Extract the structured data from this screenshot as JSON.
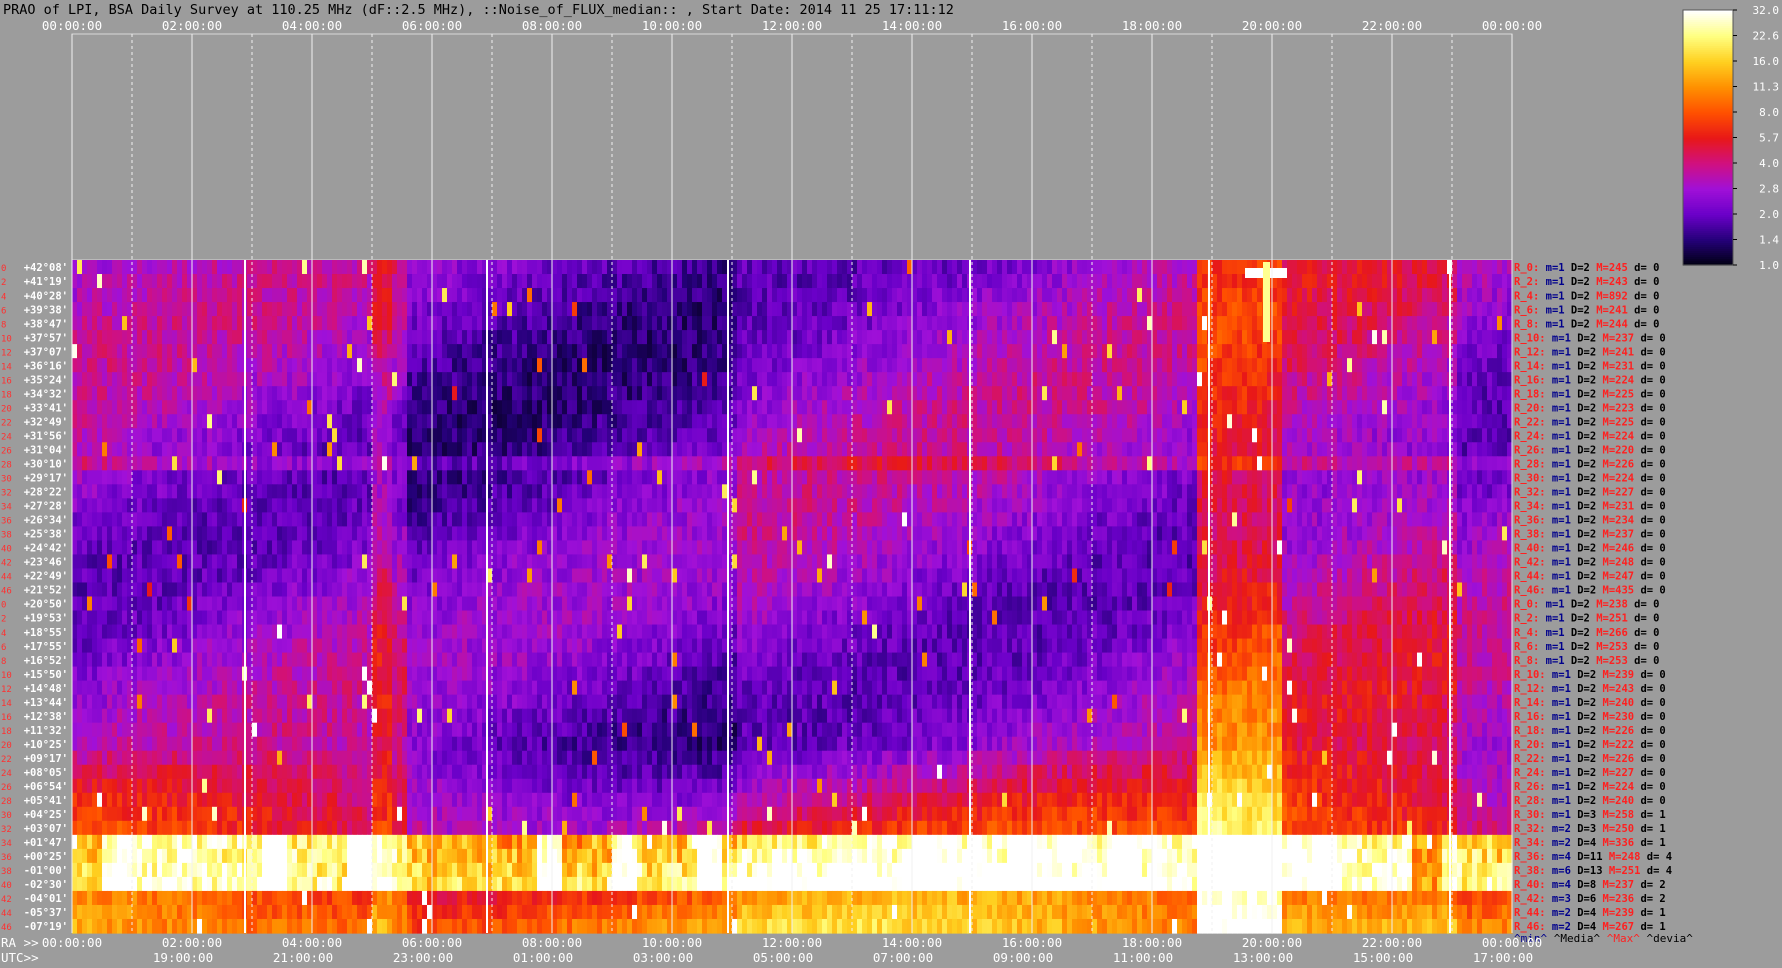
{
  "title": "PRAO of LPI, BSA Daily Survey at 110.25 MHz (dF::2.5 MHz), ::Noise_of_FLUX_median:: , Start Date: 2014 11 25 17:11:12",
  "chart_data": {
    "type": "heatmap",
    "top_axis_ticks": [
      "00:00:00",
      "02:00:00",
      "04:00:00",
      "06:00:00",
      "08:00:00",
      "10:00:00",
      "12:00:00",
      "14:00:00",
      "16:00:00",
      "18:00:00",
      "20:00:00",
      "22:00:00",
      "00:00:00"
    ],
    "bottom_axis_ra_ticks": [
      "00:00:00",
      "02:00:00",
      "04:00:00",
      "06:00:00",
      "08:00:00",
      "10:00:00",
      "12:00:00",
      "14:00:00",
      "16:00:00",
      "18:00:00",
      "20:00:00",
      "22:00:00",
      "00:00:00"
    ],
    "bottom_axis_utc_ticks": [
      "19:00:00",
      "21:00:00",
      "23:00:00",
      "01:00:00",
      "03:00:00",
      "05:00:00",
      "07:00:00",
      "09:00:00",
      "11:00:00",
      "13:00:00",
      "15:00:00",
      "17:00:00"
    ],
    "ra_label": "RA >>",
    "utc_label": "UTC>>",
    "colorbar": {
      "ticks": [
        "32.0",
        "22.6",
        "16.0",
        "11.3",
        "8.0",
        "5.7",
        "4.0",
        "2.8",
        "2.0",
        "1.4",
        "1.0"
      ],
      "range": [
        1.0,
        32.0
      ],
      "scale": "log",
      "colormap": [
        "#000010",
        "#240078",
        "#6a00c8",
        "#a010d8",
        "#d01080",
        "#e81818",
        "#ff5000",
        "#ff9000",
        "#ffd020",
        "#ffff80",
        "#ffffff"
      ]
    },
    "declinations": [
      "+42°08'",
      "+41°19'",
      "+40°28'",
      "+39°38'",
      "+38°47'",
      "+37°57'",
      "+37°07'",
      "+36°16'",
      "+35°24'",
      "+34°32'",
      "+33°41'",
      "+32°49'",
      "+31°56'",
      "+31°04'",
      "+30°10'",
      "+29°17'",
      "+28°22'",
      "+27°28'",
      "+26°34'",
      "+25°38'",
      "+24°42'",
      "+23°46'",
      "+22°49'",
      "+21°52'",
      "+20°50'",
      "+19°53'",
      "+18°55'",
      "+17°55'",
      "+16°52'",
      "+15°50'",
      "+14°48'",
      "+13°44'",
      "+12°38'",
      "+11°32'",
      "+10°25'",
      "+09°17'",
      "+08°05'",
      "+06°54'",
      "+05°41'",
      "+04°25'",
      "+03°07'",
      "+01°47'",
      "+00°25'",
      "-01°00'",
      "-02°30'",
      "-04°01'",
      "-05°37'",
      "-07°19'"
    ],
    "beam_numbers_left": [
      "0",
      "2",
      "4",
      "6",
      "8",
      "10",
      "12",
      "14",
      "16",
      "18",
      "20",
      "22",
      "24",
      "26",
      "28",
      "30",
      "32",
      "34",
      "36",
      "38",
      "40",
      "42",
      "44",
      "46",
      "0",
      "2",
      "4",
      "6",
      "8",
      "10",
      "12",
      "14",
      "16",
      "18",
      "20",
      "22",
      "24",
      "26",
      "28",
      "30",
      "32",
      "34",
      "36",
      "38",
      "40",
      "42",
      "44",
      "46"
    ],
    "row_stats": [
      {
        "r": "R_0:",
        "m": "m=1",
        "D": "D=2",
        "M": "M=245",
        "d": "d= 0"
      },
      {
        "r": "R_2:",
        "m": "m=1",
        "D": "D=2",
        "M": "M=243",
        "d": "d= 0"
      },
      {
        "r": "R_4:",
        "m": "m=1",
        "D": "D=2",
        "M": "M=892",
        "d": "d= 0"
      },
      {
        "r": "R_6:",
        "m": "m=1",
        "D": "D=2",
        "M": "M=241",
        "d": "d= 0"
      },
      {
        "r": "R_8:",
        "m": "m=1",
        "D": "D=2",
        "M": "M=244",
        "d": "d= 0"
      },
      {
        "r": "R_10:",
        "m": "m=1",
        "D": "D=2",
        "M": "M=237",
        "d": "d= 0"
      },
      {
        "r": "R_12:",
        "m": "m=1",
        "D": "D=2",
        "M": "M=241",
        "d": "d= 0"
      },
      {
        "r": "R_14:",
        "m": "m=1",
        "D": "D=2",
        "M": "M=231",
        "d": "d= 0"
      },
      {
        "r": "R_16:",
        "m": "m=1",
        "D": "D=2",
        "M": "M=224",
        "d": "d= 0"
      },
      {
        "r": "R_18:",
        "m": "m=1",
        "D": "D=2",
        "M": "M=225",
        "d": "d= 0"
      },
      {
        "r": "R_20:",
        "m": "m=1",
        "D": "D=2",
        "M": "M=223",
        "d": "d= 0"
      },
      {
        "r": "R_22:",
        "m": "m=1",
        "D": "D=2",
        "M": "M=225",
        "d": "d= 0"
      },
      {
        "r": "R_24:",
        "m": "m=1",
        "D": "D=2",
        "M": "M=224",
        "d": "d= 0"
      },
      {
        "r": "R_26:",
        "m": "m=1",
        "D": "D=2",
        "M": "M=220",
        "d": "d= 0"
      },
      {
        "r": "R_28:",
        "m": "m=1",
        "D": "D=2",
        "M": "M=226",
        "d": "d= 0"
      },
      {
        "r": "R_30:",
        "m": "m=1",
        "D": "D=2",
        "M": "M=224",
        "d": "d= 0"
      },
      {
        "r": "R_32:",
        "m": "m=1",
        "D": "D=2",
        "M": "M=227",
        "d": "d= 0"
      },
      {
        "r": "R_34:",
        "m": "m=1",
        "D": "D=2",
        "M": "M=231",
        "d": "d= 0"
      },
      {
        "r": "R_36:",
        "m": "m=1",
        "D": "D=2",
        "M": "M=234",
        "d": "d= 0"
      },
      {
        "r": "R_38:",
        "m": "m=1",
        "D": "D=2",
        "M": "M=237",
        "d": "d= 0"
      },
      {
        "r": "R_40:",
        "m": "m=1",
        "D": "D=2",
        "M": "M=246",
        "d": "d= 0"
      },
      {
        "r": "R_42:",
        "m": "m=1",
        "D": "D=2",
        "M": "M=248",
        "d": "d= 0"
      },
      {
        "r": "R_44:",
        "m": "m=1",
        "D": "D=2",
        "M": "M=247",
        "d": "d= 0"
      },
      {
        "r": "R_46:",
        "m": "m=1",
        "D": "D=2",
        "M": "M=435",
        "d": "d= 0"
      },
      {
        "r": "R_0:",
        "m": "m=1",
        "D": "D=2",
        "M": "M=238",
        "d": "d= 0"
      },
      {
        "r": "R_2:",
        "m": "m=1",
        "D": "D=2",
        "M": "M=251",
        "d": "d= 0"
      },
      {
        "r": "R_4:",
        "m": "m=1",
        "D": "D=2",
        "M": "M=266",
        "d": "d= 0"
      },
      {
        "r": "R_6:",
        "m": "m=1",
        "D": "D=2",
        "M": "M=253",
        "d": "d= 0"
      },
      {
        "r": "R_8:",
        "m": "m=1",
        "D": "D=2",
        "M": "M=253",
        "d": "d= 0"
      },
      {
        "r": "R_10:",
        "m": "m=1",
        "D": "D=2",
        "M": "M=239",
        "d": "d= 0"
      },
      {
        "r": "R_12:",
        "m": "m=1",
        "D": "D=2",
        "M": "M=243",
        "d": "d= 0"
      },
      {
        "r": "R_14:",
        "m": "m=1",
        "D": "D=2",
        "M": "M=240",
        "d": "d= 0"
      },
      {
        "r": "R_16:",
        "m": "m=1",
        "D": "D=2",
        "M": "M=230",
        "d": "d= 0"
      },
      {
        "r": "R_18:",
        "m": "m=1",
        "D": "D=2",
        "M": "M=226",
        "d": "d= 0"
      },
      {
        "r": "R_20:",
        "m": "m=1",
        "D": "D=2",
        "M": "M=222",
        "d": "d= 0"
      },
      {
        "r": "R_22:",
        "m": "m=1",
        "D": "D=2",
        "M": "M=226",
        "d": "d= 0"
      },
      {
        "r": "R_24:",
        "m": "m=1",
        "D": "D=2",
        "M": "M=227",
        "d": "d= 0"
      },
      {
        "r": "R_26:",
        "m": "m=1",
        "D": "D=2",
        "M": "M=224",
        "d": "d= 0"
      },
      {
        "r": "R_28:",
        "m": "m=1",
        "D": "D=2",
        "M": "M=240",
        "d": "d= 0"
      },
      {
        "r": "R_30:",
        "m": "m=1",
        "D": "D=3",
        "M": "M=258",
        "d": "d= 1"
      },
      {
        "r": "R_32:",
        "m": "m=2",
        "D": "D=3",
        "M": "M=250",
        "d": "d= 1"
      },
      {
        "r": "R_34:",
        "m": "m=2",
        "D": "D=4",
        "M": "M=336",
        "d": "d= 1"
      },
      {
        "r": "R_36:",
        "m": "m=4",
        "D": "D=11",
        "M": "M=248",
        "d": "d= 4"
      },
      {
        "r": "R_38:",
        "m": "m=6",
        "D": "D=13",
        "M": "M=251",
        "d": "d= 4"
      },
      {
        "r": "R_40:",
        "m": "m=4",
        "D": "D=8",
        "M": "M=237",
        "d": "d= 2"
      },
      {
        "r": "R_42:",
        "m": "m=3",
        "D": "D=6",
        "M": "M=236",
        "d": "d= 2"
      },
      {
        "r": "R_44:",
        "m": "m=2",
        "D": "D=4",
        "M": "M=239",
        "d": "d= 1"
      },
      {
        "r": "R_46:",
        "m": "m=2",
        "D": "D=4",
        "M": "M=267",
        "d": "d= 1"
      }
    ],
    "stat_header": {
      "min": "^min^",
      "media": "^Media^",
      "max": "^Max^",
      "devia": "^devia^"
    },
    "grid": true
  }
}
